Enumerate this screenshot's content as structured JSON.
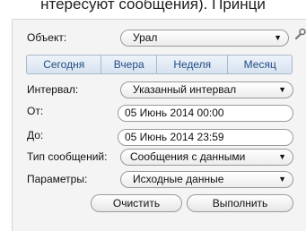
{
  "background_text": "нтересуют  сообщения). Принци",
  "object": {
    "label": "Объект:",
    "value": "Урал"
  },
  "period_buttons": [
    "Сегодня",
    "Вчера",
    "Неделя",
    "Месяц"
  ],
  "interval": {
    "label": "Интервал:",
    "value": "Указанный интервал"
  },
  "from": {
    "label": "От:",
    "value": "05 Июнь 2014 00:00"
  },
  "to": {
    "label": "До:",
    "value": "05 Июнь 2014 23:59"
  },
  "message_type": {
    "label": "Тип сообщений:",
    "value": "Сообщения с данными"
  },
  "parameters": {
    "label": "Параметры:",
    "value": "Исходные данные"
  },
  "actions": {
    "clear": "Очистить",
    "execute": "Выполнить"
  },
  "icons": {
    "dropdown": "chevron-down-icon",
    "settings": "wrench-icon"
  },
  "colors": {
    "segment_text": "#1f4d82",
    "panel_bg": "#f4f4f4"
  }
}
